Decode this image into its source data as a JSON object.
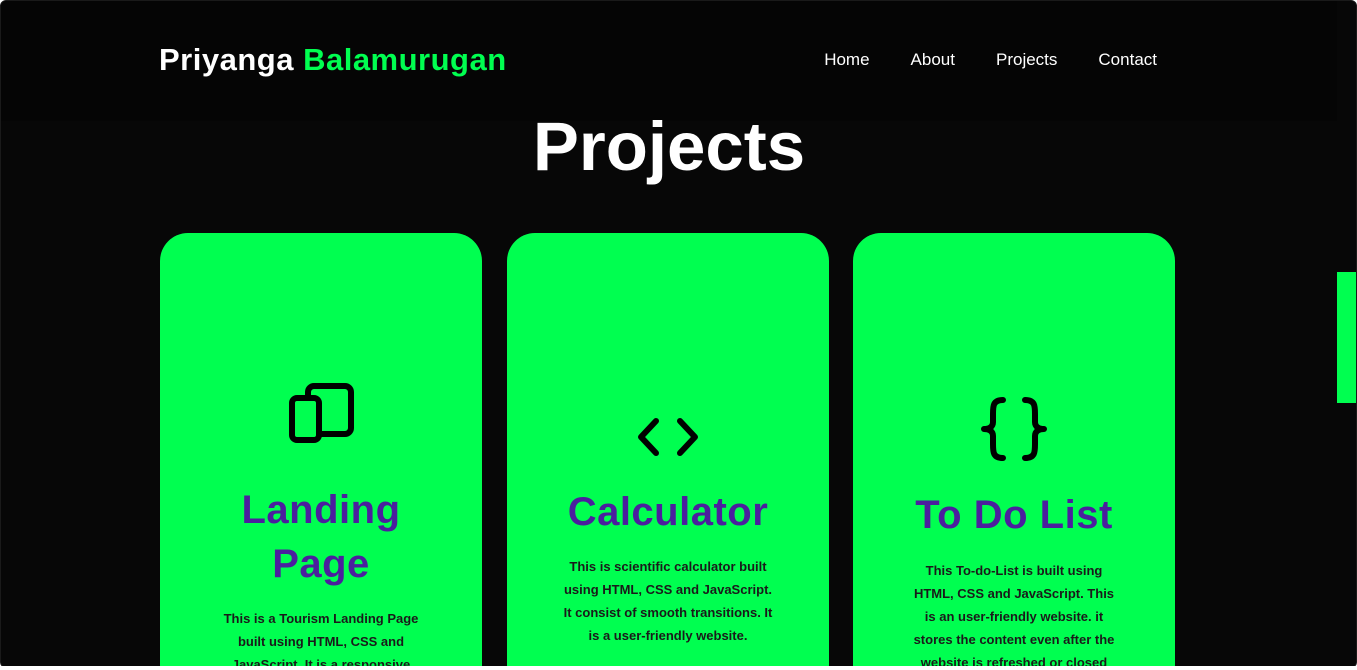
{
  "header": {
    "brand_first": "Priyanga",
    "brand_last": "Balamurugan",
    "nav": [
      "Home",
      "About",
      "Projects",
      "Contact"
    ]
  },
  "main": {
    "title": "Projects",
    "cards": [
      {
        "icon": "devices-icon",
        "title_lines": [
          "Landing",
          "Page"
        ],
        "desc_lines": [
          "This is a Tourism Landing Page",
          "built using HTML, CSS and",
          "JavaScript. It is a responsive"
        ]
      },
      {
        "icon": "code-brackets-icon",
        "title_lines": [
          "Calculator"
        ],
        "desc_lines": [
          "This is scientific calculator built",
          "using HTML, CSS and JavaScript.",
          "It consist of smooth transitions. It",
          "is a user-friendly website."
        ]
      },
      {
        "icon": "curly-braces-icon",
        "title_lines": [
          "To Do List"
        ],
        "desc_lines": [
          "This To-do-List is built using",
          "HTML, CSS and JavaScript. This",
          "is an user-friendly website. it",
          "stores the content even after the",
          "website is refreshed or closed"
        ]
      }
    ]
  },
  "colors": {
    "background": "#070707",
    "accent_green": "#00ff50",
    "card_title": "#4b1f9e",
    "text_white": "#ffffff"
  }
}
